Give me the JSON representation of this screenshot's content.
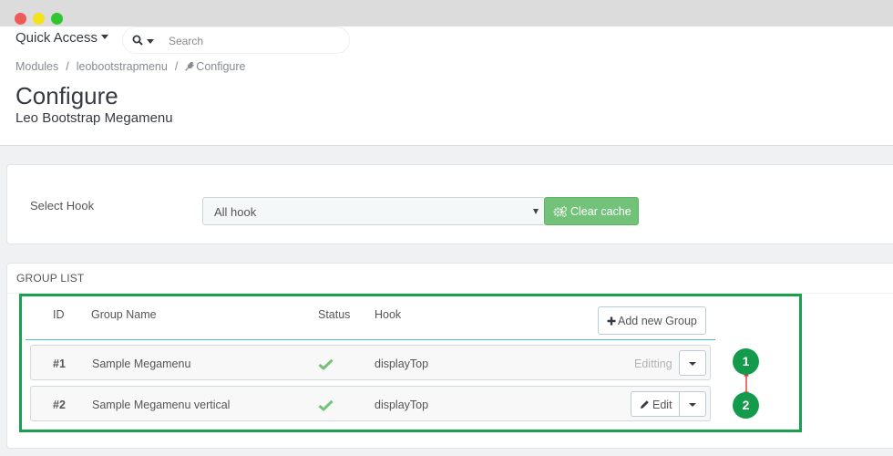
{
  "header": {
    "quick_access": "Quick Access",
    "search_placeholder": "Search"
  },
  "breadcrumb": {
    "items": [
      "Modules",
      "leobootstrapmenu",
      "Configure"
    ],
    "separator": "/"
  },
  "page": {
    "title": "Configure",
    "subtitle": "Leo Bootstrap Megamenu"
  },
  "hook_panel": {
    "label": "Select Hook",
    "selected": "All hook",
    "clear_cache": "Clear cache"
  },
  "group_list": {
    "heading": "GROUP LIST",
    "columns": [
      "ID",
      "Group Name",
      "Status",
      "Hook"
    ],
    "add_button": "Add new Group",
    "rows": [
      {
        "id": "#1",
        "name": "Sample Megamenu",
        "status": "enabled",
        "hook": "displayTop",
        "action": "Editting"
      },
      {
        "id": "#2",
        "name": "Sample Megamenu vertical",
        "status": "enabled",
        "hook": "displayTop",
        "action": "Edit"
      }
    ]
  },
  "annotations": {
    "badge_1": "1",
    "badge_2": "2",
    "highlight_color": "#1aa04f"
  },
  "colors": {
    "accent_green": "#72c279",
    "badge_green": "#149a4b",
    "check_green": "#72c279",
    "divider_blue": "#4bbfd6"
  }
}
